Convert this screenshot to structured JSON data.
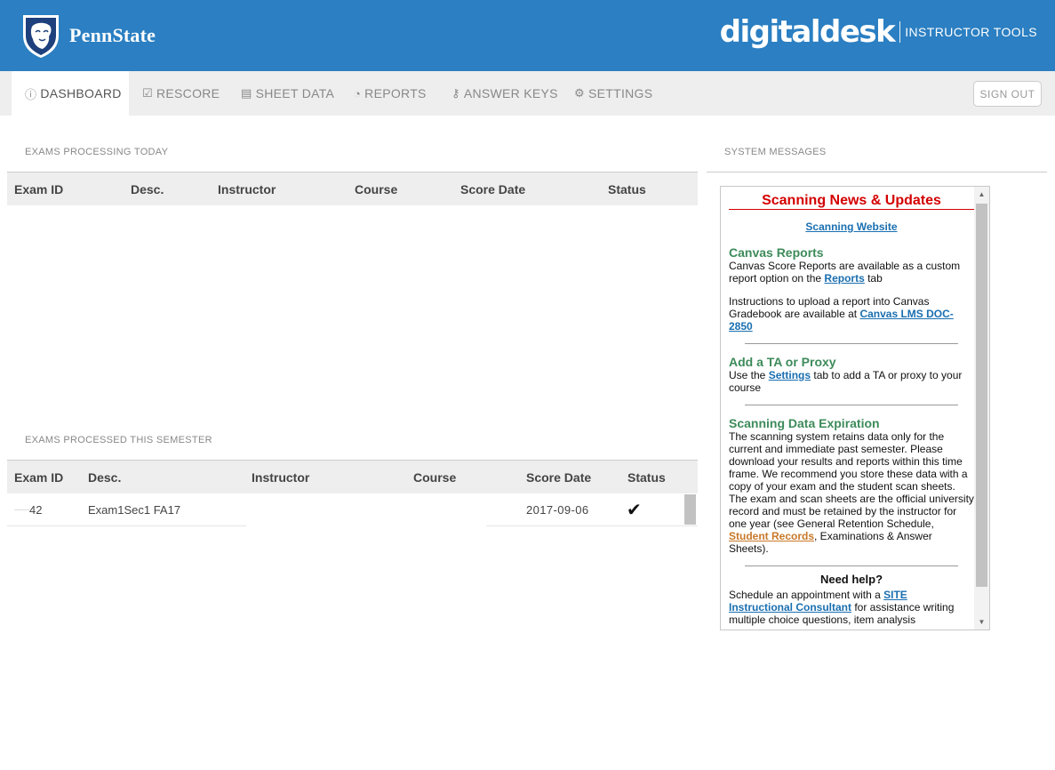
{
  "header": {
    "university": "PennState",
    "product": "digitaldesk",
    "product_sub": "INSTRUCTOR TOOLS"
  },
  "nav": {
    "tabs": [
      {
        "label": "DASHBOARD",
        "icon": "info-icon"
      },
      {
        "label": "RESCORE",
        "icon": "check-square-icon"
      },
      {
        "label": "SHEET DATA",
        "icon": "document-icon"
      },
      {
        "label": "REPORTS",
        "icon": "pie-chart-icon"
      },
      {
        "label": "ANSWER KEYS",
        "icon": "key-icon"
      },
      {
        "label": "SETTINGS",
        "icon": "gear-icon"
      }
    ],
    "signout": "SIGN OUT"
  },
  "today": {
    "title": "EXAMS PROCESSING TODAY",
    "columns": [
      "Exam ID",
      "Desc.",
      "Instructor",
      "Course",
      "Score Date",
      "Status"
    ]
  },
  "semester": {
    "title": "EXAMS PROCESSED THIS SEMESTER",
    "columns": [
      "Exam ID",
      "Desc.",
      "Instructor",
      "Course",
      "Score Date",
      "Status"
    ],
    "rows": [
      {
        "exam_id": "42",
        "desc": "Exam1Sec1 FA17",
        "instructor": "",
        "course": "",
        "score_date": "2017-09-06",
        "status": "✔"
      }
    ]
  },
  "system": {
    "title": "SYSTEM MESSAGES",
    "news_title": "Scanning News & Updates",
    "scanning_website": "Scanning Website",
    "canvas_h": "Canvas Reports",
    "canvas_p1a": "Canvas Score Reports are available as a custom report option on the ",
    "canvas_p1_link": "Reports",
    "canvas_p1b": " tab",
    "canvas_p2a": "Instructions to upload a report into Canvas Gradebook are available at ",
    "canvas_p2_link": "Canvas LMS DOC-2850",
    "ta_h": "Add a TA or Proxy",
    "ta_pa": "Use the ",
    "ta_link": "Settings",
    "ta_pb": " tab to add a TA or proxy to your course",
    "exp_h": "Scanning Data Expiration",
    "exp_pa": "The scanning system retains data only for the current and immediate past semester. Please download your results and reports within this time frame. We recommend you store these data with a copy of your exam and the student scan sheets. The exam and scan sheets are the official university record and must be retained by the instructor for one year (see General Retention Schedule, ",
    "exp_link": "Student Records",
    "exp_pb": ", Examinations & Answer Sheets).",
    "help_h": "Need help?",
    "help_pa": "Schedule an appointment with a ",
    "help_link": "SITE Instructional Consultant",
    "help_pb": " for assistance writing multiple choice questions, item analysis"
  }
}
